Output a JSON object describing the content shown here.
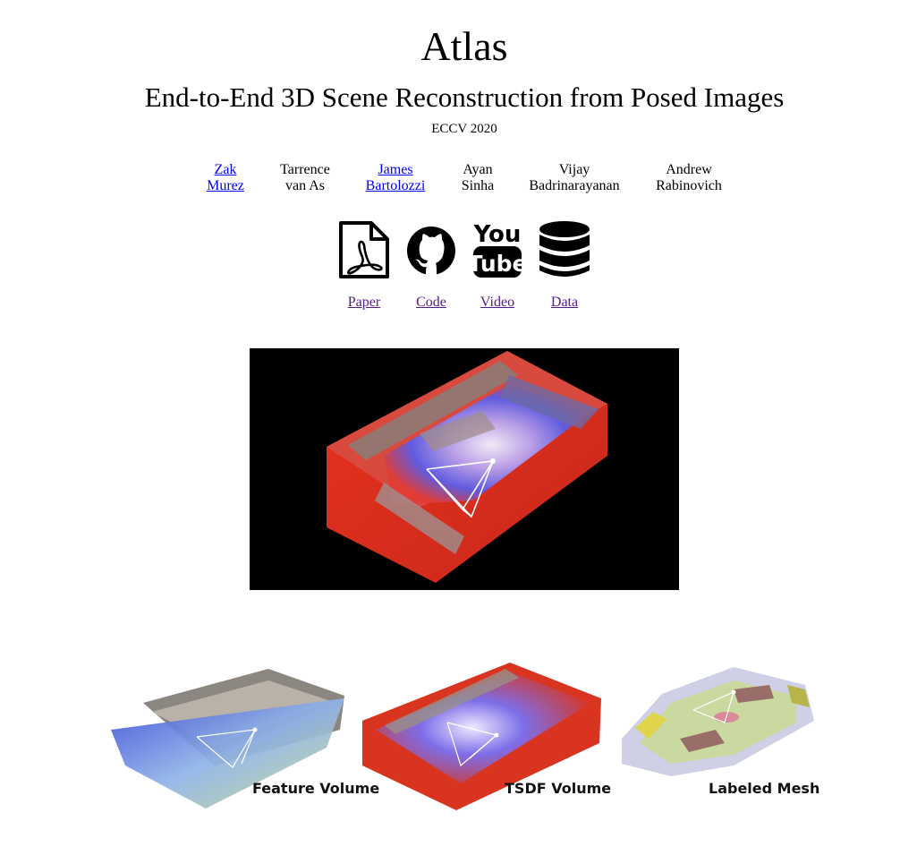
{
  "title": "Atlas",
  "subtitle": "End-to-End 3D Scene Reconstruction from Posed Images",
  "venue": "ECCV 2020",
  "authors": [
    {
      "first": "Zak",
      "last": "Murez",
      "linked": true
    },
    {
      "first": "Tarrence",
      "last": "van As",
      "linked": false
    },
    {
      "first": "James",
      "last": "Bartolozzi",
      "linked": true
    },
    {
      "first": "Ayan",
      "last": "Sinha",
      "linked": false
    },
    {
      "first": "Vijay",
      "last": "Badrinarayanan",
      "linked": false
    },
    {
      "first": "Andrew",
      "last": "Rabinovich",
      "linked": false
    }
  ],
  "resources": [
    {
      "label": "Paper",
      "icon": "pdf-file-icon"
    },
    {
      "label": "Code",
      "icon": "github-icon"
    },
    {
      "label": "Video",
      "icon": "youtube-icon"
    },
    {
      "label": "Data",
      "icon": "database-icon"
    }
  ],
  "youtube_icon_text": {
    "top": "You",
    "bottom": "Tube"
  },
  "figure_captions": [
    "Feature Volume",
    "TSDF Volume",
    "Labeled Mesh"
  ],
  "colors": {
    "link": "#0000ee",
    "visited_link": "#551a8b",
    "tsdf_red": "#e8321e"
  }
}
